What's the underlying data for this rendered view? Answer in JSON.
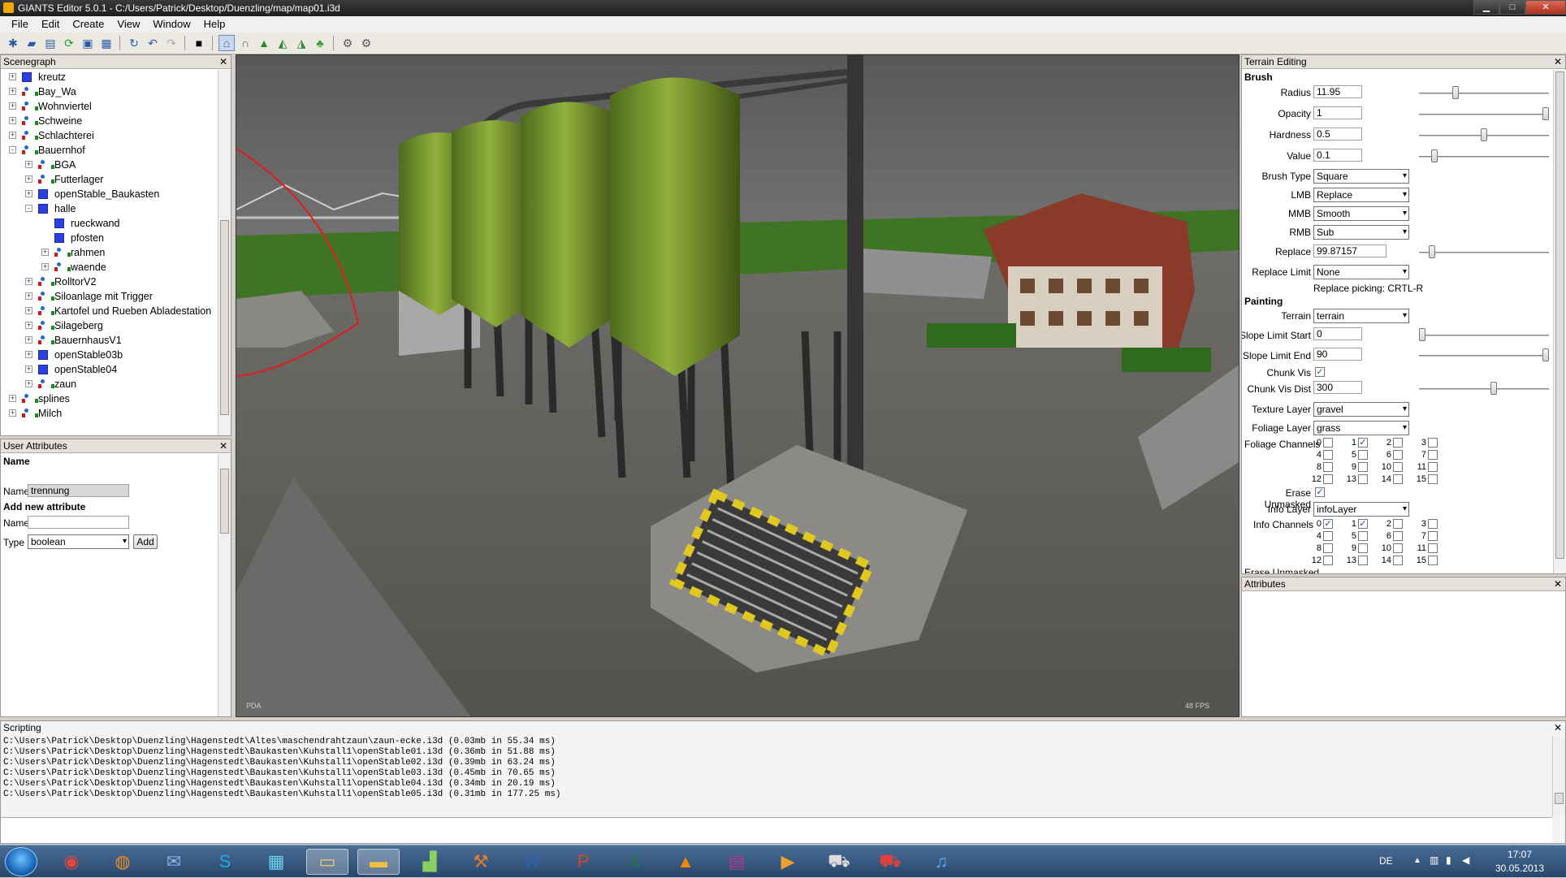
{
  "window": {
    "title": "GIANTS Editor 5.0.1 - C:/Users/Patrick/Desktop/Duenzling/map/map01.i3d",
    "controls": {
      "minimize": "▁",
      "maximize": "□",
      "close": "✕"
    }
  },
  "menu": [
    "File",
    "Edit",
    "Create",
    "View",
    "Window",
    "Help"
  ],
  "toolbar": {
    "icons": [
      "new-icon",
      "open-icon",
      "save-as-icon",
      "refresh-icon",
      "save-icon",
      "save-all-icon",
      "reload-icon",
      "undo-icon",
      "redo-icon",
      "stop-icon",
      "select-icon",
      "move-icon",
      "terrain-sculpt-icon",
      "terrain-paint-icon",
      "foliage-paint-icon",
      "plant-icon",
      "render-settings-icon",
      "render-settings-2-icon"
    ]
  },
  "scenegraph": {
    "title": "Scenegraph",
    "nodes": [
      {
        "label": "kreutz",
        "depth": 0,
        "icon": "cube",
        "exp": "+"
      },
      {
        "label": "Bay_Wa",
        "depth": 0,
        "icon": "transformgroup",
        "exp": "+"
      },
      {
        "label": "Wohnviertel",
        "depth": 0,
        "icon": "transformgroup",
        "exp": "+"
      },
      {
        "label": "Schweine",
        "depth": 0,
        "icon": "transformgroup",
        "exp": "+"
      },
      {
        "label": "Schlachterei",
        "depth": 0,
        "icon": "transformgroup",
        "exp": "+"
      },
      {
        "label": "Bauernhof",
        "depth": 0,
        "icon": "transformgroup",
        "exp": "-"
      },
      {
        "label": "BGA",
        "depth": 1,
        "icon": "transformgroup",
        "exp": "+"
      },
      {
        "label": "Futterlager",
        "depth": 1,
        "icon": "transformgroup",
        "exp": "+"
      },
      {
        "label": "openStable_Baukasten",
        "depth": 1,
        "icon": "cube",
        "exp": "+"
      },
      {
        "label": "halle",
        "depth": 1,
        "icon": "cube",
        "exp": "-"
      },
      {
        "label": "rueckwand",
        "depth": 2,
        "icon": "cube",
        "exp": ""
      },
      {
        "label": "pfosten",
        "depth": 2,
        "icon": "cube",
        "exp": ""
      },
      {
        "label": "rahmen",
        "depth": 2,
        "icon": "transformgroup",
        "exp": "+"
      },
      {
        "label": "waende",
        "depth": 2,
        "icon": "transformgroup",
        "exp": "+"
      },
      {
        "label": "RolltorV2",
        "depth": 1,
        "icon": "transformgroup",
        "exp": "+"
      },
      {
        "label": "Siloanlage mit Trigger",
        "depth": 1,
        "icon": "transformgroup",
        "exp": "+"
      },
      {
        "label": "Kartofel und Rueben Abladestation",
        "depth": 1,
        "icon": "transformgroup",
        "exp": "+"
      },
      {
        "label": "Silageberg",
        "depth": 1,
        "icon": "transformgroup",
        "exp": "+"
      },
      {
        "label": "BauernhausV1",
        "depth": 1,
        "icon": "transformgroup",
        "exp": "+"
      },
      {
        "label": "openStable03b",
        "depth": 1,
        "icon": "cube",
        "exp": "+"
      },
      {
        "label": "openStable04",
        "depth": 1,
        "icon": "cube",
        "exp": "+"
      },
      {
        "label": "zaun",
        "depth": 1,
        "icon": "transformgroup",
        "exp": "+"
      },
      {
        "label": "splines",
        "depth": 0,
        "icon": "transformgroup",
        "exp": "+"
      },
      {
        "label": "Milch",
        "depth": 0,
        "icon": "transformgroup",
        "exp": "+"
      }
    ]
  },
  "user_attributes": {
    "title": "User Attributes",
    "name_header": "Name",
    "name_label": "Name",
    "name_value": "trennung",
    "add_header": "Add new attribute",
    "new_name_label": "Name",
    "new_name_value": "",
    "type_label": "Type",
    "type_value": "boolean",
    "add_button": "Add"
  },
  "viewport": {
    "left_overlay": "PDA",
    "fps": "48 FPS"
  },
  "terrain_editing": {
    "title": "Terrain Editing",
    "brush_header": "Brush",
    "radius_label": "Radius",
    "radius_value": "11.95",
    "radius_level": 0.27,
    "opacity_label": "Opacity",
    "opacity_value": "1",
    "opacity_level": 1.0,
    "hardness_label": "Hardness",
    "hardness_value": "0.5",
    "hardness_level": 0.5,
    "value_label": "Value",
    "value_value": "0.1",
    "value_level": 0.1,
    "brush_type_label": "Brush Type",
    "brush_type_value": "Square",
    "lmb_label": "LMB",
    "lmb_value": "Replace",
    "mmb_label": "MMB",
    "mmb_value": "Smooth",
    "rmb_label": "RMB",
    "rmb_value": "Sub",
    "replace_label": "Replace",
    "replace_value": "99.87157",
    "replace_level": 0.08,
    "replace_limit_label": "Replace Limit",
    "replace_limit_value": "None",
    "replace_picking": "Replace picking: CRTL-R",
    "painting_header": "Painting",
    "terrain_label": "Terrain",
    "terrain_value": "terrain",
    "slope_start_label": "Slope Limit Start",
    "slope_start_value": "0",
    "slope_start_level": 0.0,
    "slope_end_label": "Slope Limit End",
    "slope_end_value": "90",
    "slope_end_level": 1.0,
    "chunk_vis_label": "Chunk Vis",
    "chunk_vis_checked": "✓",
    "chunk_vis_dist_label": "Chunk Vis Dist",
    "chunk_vis_dist_value": "300",
    "chunk_vis_dist_level": 0.58,
    "texture_layer_label": "Texture Layer",
    "texture_layer_value": "gravel",
    "foliage_layer_label": "Foliage Layer",
    "foliage_layer_value": "grass",
    "foliage_channels_label": "Foliage Channels",
    "foliage_checked": [
      1
    ],
    "erase_unmasked_label": "Erase Unmasked",
    "erase_unmasked_checked": "✓",
    "info_layer_label": "Info Layer",
    "info_layer_value": "infoLayer",
    "info_channels_label": "Info Channels",
    "info_checked": [
      0,
      1
    ],
    "erase_unmasked2_label": "Erase Unmasked",
    "channel_numbers": [
      "0",
      "1",
      "2",
      "3",
      "4",
      "5",
      "6",
      "7",
      "8",
      "9",
      "10",
      "11",
      "12",
      "13",
      "14",
      "15"
    ]
  },
  "attributes": {
    "title": "Attributes"
  },
  "scripting": {
    "title": "Scripting",
    "lines": [
      "C:\\Users\\Patrick\\Desktop\\Duenzling\\Hagenstedt\\Altes\\maschendrahtzaun\\zaun-ecke.i3d (0.03mb in 55.34 ms)",
      "C:\\Users\\Patrick\\Desktop\\Duenzling\\Hagenstedt\\Baukasten\\Kuhstall1\\openStable01.i3d (0.36mb in 51.88 ms)",
      "C:\\Users\\Patrick\\Desktop\\Duenzling\\Hagenstedt\\Baukasten\\Kuhstall1\\openStable02.i3d (0.39mb in 63.24 ms)",
      "C:\\Users\\Patrick\\Desktop\\Duenzling\\Hagenstedt\\Baukasten\\Kuhstall1\\openStable03.i3d (0.45mb in 70.65 ms)",
      "C:\\Users\\Patrick\\Desktop\\Duenzling\\Hagenstedt\\Baukasten\\Kuhstall1\\openStable04.i3d (0.34mb in 20.19 ms)",
      "C:\\Users\\Patrick\\Desktop\\Duenzling\\Hagenstedt\\Baukasten\\Kuhstall1\\openStable05.i3d (0.31mb in 177.25 ms)"
    ]
  },
  "taskbar": {
    "apps": [
      {
        "name": "chrome-icon",
        "glyph": "◉",
        "color": "#e8453c"
      },
      {
        "name": "firefox-icon",
        "glyph": "◍",
        "color": "#f08a24"
      },
      {
        "name": "thunderbird-icon",
        "glyph": "✉",
        "color": "#8ab4e8"
      },
      {
        "name": "skype-icon",
        "glyph": "S",
        "color": "#1fa7e8"
      },
      {
        "name": "image-viewer-icon",
        "glyph": "▦",
        "color": "#6ad0f0"
      },
      {
        "name": "file-explorer-icon",
        "glyph": "▭",
        "color": "#f0d070"
      },
      {
        "name": "giants-editor-icon",
        "glyph": "▬",
        "color": "#f2c040"
      },
      {
        "name": "chart-app-icon",
        "glyph": "▟",
        "color": "#8ad060"
      },
      {
        "name": "tool-app-icon",
        "glyph": "⚒",
        "color": "#e07830"
      },
      {
        "name": "word-icon",
        "glyph": "W",
        "color": "#2b5fb8"
      },
      {
        "name": "powerpoint-icon",
        "glyph": "P",
        "color": "#d24726"
      },
      {
        "name": "excel-icon",
        "glyph": "X",
        "color": "#1f7a3f"
      },
      {
        "name": "vlc-icon",
        "glyph": "▲",
        "color": "#f08a00"
      },
      {
        "name": "winrar-icon",
        "glyph": "▤",
        "color": "#b03a8a"
      },
      {
        "name": "media-player-icon",
        "glyph": "▶",
        "color": "#f0a030"
      },
      {
        "name": "tractor-icon",
        "glyph": "⛟",
        "color": "#dddddd"
      },
      {
        "name": "farming-simulator-icon",
        "glyph": "⛟",
        "color": "#e04040"
      },
      {
        "name": "itunes-icon",
        "glyph": "♫",
        "color": "#5aa8f0"
      }
    ],
    "language": "DE",
    "time": "17:07",
    "date": "30.05.2013"
  }
}
